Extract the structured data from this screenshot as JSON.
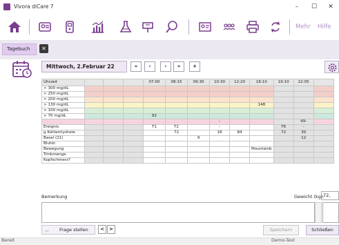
{
  "window": {
    "title": "Vivora diCare 7"
  },
  "toolbar": {
    "more_label": "Mehr",
    "help_label": "Hilfe"
  },
  "tabs": [
    {
      "label": "Tagebuch"
    }
  ],
  "diary": {
    "date_label": "Mittwoch, 2.Februar 22",
    "nav": {
      "first": "«",
      "prev": "‹",
      "next": "›",
      "last": "»",
      "add": "+"
    }
  },
  "grid": {
    "times": [
      "07:00",
      "08:15",
      "09:30",
      "10:30",
      "12:20",
      "18:10",
      "19:10",
      "22:05"
    ],
    "rows": [
      {
        "label": "Uhrzeit",
        "cells": [
          "",
          "",
          "",
          "07:00",
          "08:15",
          "09:30",
          "10:30",
          "12:20",
          "18:10",
          "19:10",
          "22:05",
          ""
        ]
      },
      {
        "label": "> 300 mg/dL",
        "cells": [
          "",
          "",
          "",
          "",
          "",
          "",
          "",
          "",
          "",
          "",
          "",
          ""
        ]
      },
      {
        "label": "> 250 mg/dL",
        "cells": [
          "",
          "",
          "",
          "",
          "",
          "",
          "",
          "",
          "",
          "",
          "",
          ""
        ]
      },
      {
        "label": "> 200 mg/dL",
        "cells": [
          "",
          "",
          "",
          "",
          "",
          "",
          "",
          "",
          "",
          "",
          "",
          ""
        ]
      },
      {
        "label": "> 130 mg/dL",
        "cells": [
          "",
          "",
          "",
          "",
          "",
          "",
          "",
          "",
          "148",
          "",
          "",
          ""
        ]
      },
      {
        "label": "> 100 mg/dL",
        "cells": [
          "",
          "",
          "",
          "",
          "",
          "",
          "",
          "",
          "",
          "",
          "",
          ""
        ]
      },
      {
        "label": ">  70 mg/dL",
        "cells": [
          "",
          "",
          "",
          "82",
          "",
          "",
          "",
          "",
          "",
          "",
          "",
          ""
        ]
      },
      {
        "label": "",
        "cells": [
          "",
          "",
          "",
          "",
          "",
          "",
          "-",
          "",
          "",
          "",
          "49-",
          ""
        ]
      },
      {
        "label": "Ereignis",
        "cells": [
          "",
          "",
          "",
          "T1",
          "T2",
          "",
          "-",
          "",
          "",
          "T6",
          "-",
          ""
        ]
      },
      {
        "label": "g Kohlenhydrate",
        "cells": [
          "",
          "",
          "",
          "",
          "72",
          "",
          "18",
          "84",
          "",
          "72",
          "30",
          ""
        ]
      },
      {
        "label": "Basal (21)",
        "cells": [
          "",
          "",
          "",
          "",
          "",
          "9",
          "",
          "",
          "",
          "",
          "12",
          ""
        ]
      },
      {
        "label": "Blutdr.",
        "cells": [
          "",
          "",
          "",
          "",
          "",
          "",
          "",
          "",
          "",
          "",
          "",
          ""
        ]
      },
      {
        "label": "Bewegung",
        "cells": [
          "",
          "",
          "",
          "",
          "",
          "",
          "",
          "",
          "Mountainb",
          "",
          "",
          ""
        ]
      },
      {
        "label": "Trinkmenge",
        "cells": [
          "",
          "",
          "",
          "",
          "",
          "",
          "",
          "",
          "",
          "",
          "",
          ""
        ]
      },
      {
        "label": "Kopfschmerz?",
        "cells": [
          "",
          "",
          "",
          "",
          "",
          "",
          "",
          "",
          "",
          "",
          "",
          ""
        ]
      }
    ]
  },
  "remarks": {
    "label": "Bemerkung",
    "weight_label": "Gewicht (kg):",
    "weight_value": "72,"
  },
  "footer": {
    "ask_label": "Frage stellen",
    "prev": "<",
    "next": ">",
    "save_label": "Speichern",
    "close_label": "Schließen"
  },
  "statusbar": {
    "left": "Bereit",
    "right": "Demo-Test"
  },
  "colors": {
    "accent": "#7a3d8f",
    "tab_bg": "#e1ccef",
    "zone_red": "#f4cfc9",
    "zone_orange": "#fbe3cc",
    "zone_yellow": "#fbf3c8",
    "zone_green": "#d7eed4",
    "zone_teal": "#cde8dd",
    "zone_pink": "#f6d4de",
    "grey": "#e2e2e2"
  }
}
